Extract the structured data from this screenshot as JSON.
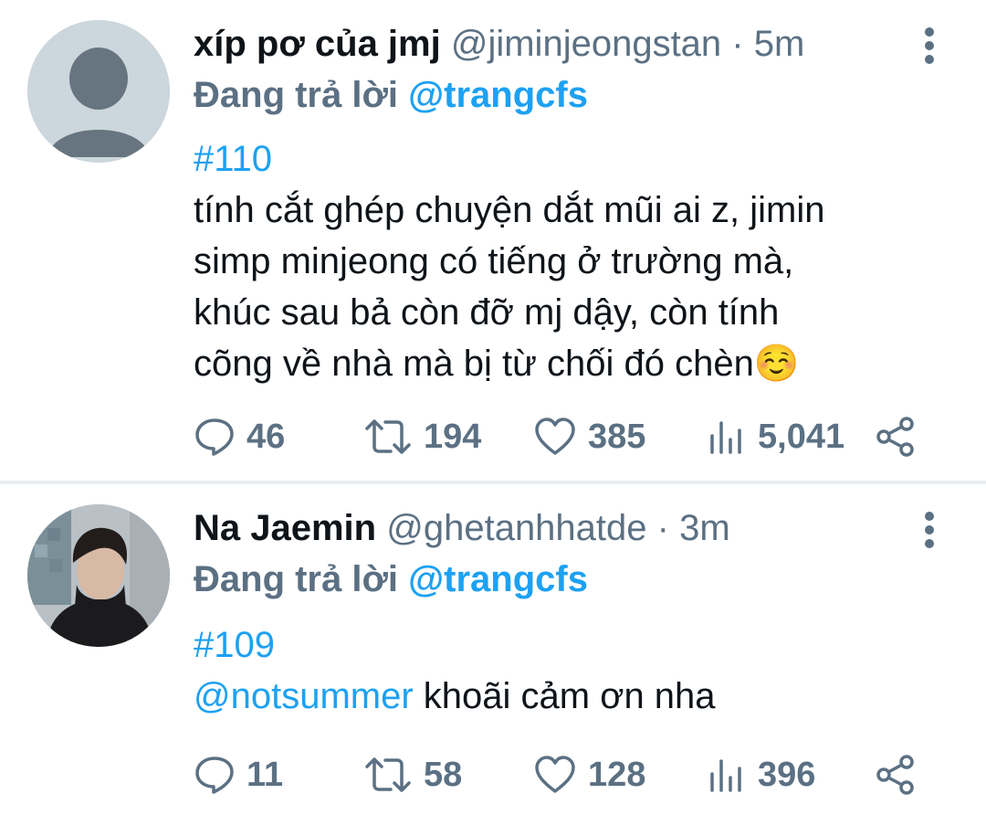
{
  "tweets": [
    {
      "author_name": "xíp pơ của jmj",
      "handle": "@jiminjeongstan",
      "separator": "·",
      "time": "5m",
      "reply_prefix": "Đang trả lời",
      "reply_to": "@trangcfs",
      "hashtag": "#110",
      "lines": [
        "tính cắt ghép chuyện dắt mũi ai z, jimin",
        "simp minjeong có tiếng ở trường mà,",
        "khúc sau bả còn đỡ mj dậy, còn tính",
        "cõng về nhà mà bị từ chối đó chèn"
      ],
      "emoji": "☺️",
      "stats": {
        "replies": "46",
        "retweets": "194",
        "likes": "385",
        "views": "5,041"
      }
    },
    {
      "author_name": "Na Jaemin",
      "handle": "@ghetanhhatde",
      "separator": "·",
      "time": "3m",
      "reply_prefix": "Đang trả lời",
      "reply_to": "@trangcfs",
      "hashtag": "#109",
      "mention": "@notsummer",
      "text": "khoãi cảm ơn nha",
      "stats": {
        "replies": "11",
        "retweets": "58",
        "likes": "128",
        "views": "396"
      }
    }
  ],
  "colors": {
    "accent": "#1da1f2",
    "muted": "#5b7083",
    "text": "#0f1419",
    "divider": "#e9ecef"
  },
  "icons": [
    "default-avatar-icon",
    "more-options-icon",
    "reply-icon",
    "retweet-icon",
    "like-icon",
    "views-icon",
    "share-icon"
  ]
}
